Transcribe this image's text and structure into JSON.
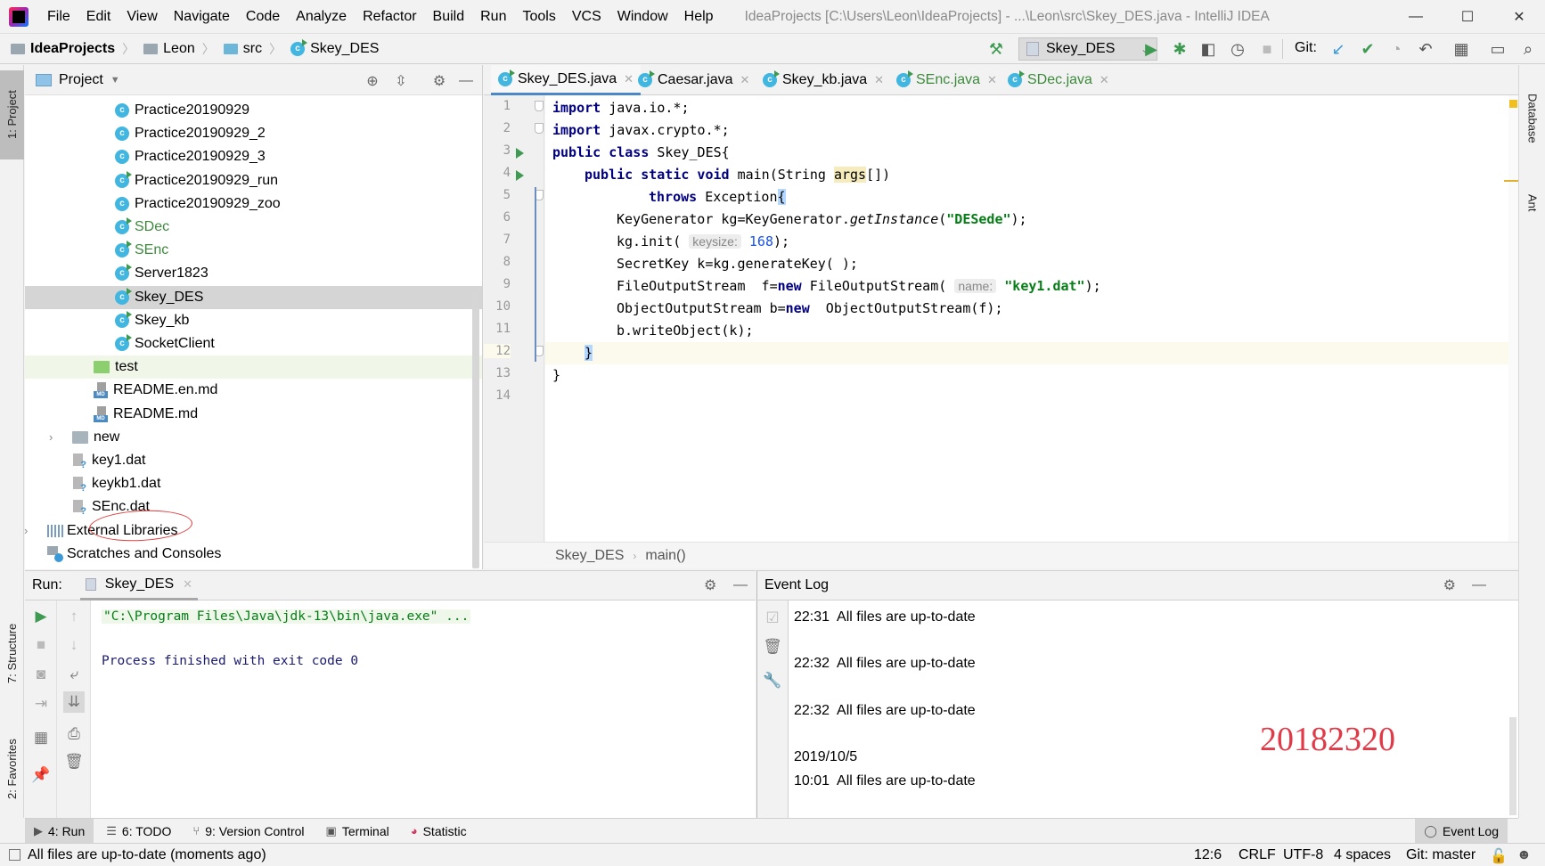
{
  "app": {
    "window_title": "IdeaProjects [C:\\Users\\Leon\\IdeaProjects] - ...\\Leon\\src\\Skey_DES.java - IntelliJ IDEA",
    "menu": [
      "File",
      "Edit",
      "View",
      "Navigate",
      "Code",
      "Analyze",
      "Refactor",
      "Build",
      "Run",
      "Tools",
      "VCS",
      "Window",
      "Help"
    ],
    "window_controls": {
      "minimize": "—",
      "maximize": "☐",
      "close": "✕"
    }
  },
  "navbar": {
    "breadcrumb": [
      "IdeaProjects",
      "Leon",
      "src",
      "Skey_DES"
    ],
    "run_config": "Skey_DES",
    "git_label": "Git:"
  },
  "project_panel": {
    "title": "Project",
    "tree": [
      {
        "label": "Practice20190929",
        "type": "class",
        "color": "normal"
      },
      {
        "label": "Practice20190929_2",
        "type": "class",
        "color": "normal"
      },
      {
        "label": "Practice20190929_3",
        "type": "class",
        "color": "normal"
      },
      {
        "label": "Practice20190929_run",
        "type": "class-run",
        "color": "normal"
      },
      {
        "label": "Practice20190929_zoo",
        "type": "class",
        "color": "normal"
      },
      {
        "label": "SDec",
        "type": "class-run",
        "color": "green"
      },
      {
        "label": "SEnc",
        "type": "class-run",
        "color": "green"
      },
      {
        "label": "Server1823",
        "type": "class-run",
        "color": "normal"
      },
      {
        "label": "Skey_DES",
        "type": "class-run",
        "color": "normal",
        "selected": true
      },
      {
        "label": "Skey_kb",
        "type": "class-run",
        "color": "normal"
      },
      {
        "label": "SocketClient",
        "type": "class-run",
        "color": "normal"
      },
      {
        "label": "test",
        "type": "folder-test"
      },
      {
        "label": "README.en.md",
        "type": "md"
      },
      {
        "label": "README.md",
        "type": "md"
      },
      {
        "label": "new",
        "type": "folder",
        "collapsed": true
      },
      {
        "label": "key1.dat",
        "type": "dat",
        "annotated": true
      },
      {
        "label": "keykb1.dat",
        "type": "dat"
      },
      {
        "label": "SEnc.dat",
        "type": "dat"
      },
      {
        "label": "External Libraries",
        "type": "libraries",
        "collapsed": true
      },
      {
        "label": "Scratches and Consoles",
        "type": "scratches"
      }
    ]
  },
  "editor": {
    "tabs": [
      {
        "label": "Skey_DES.java",
        "active": true,
        "color": "normal"
      },
      {
        "label": "Caesar.java",
        "color": "normal"
      },
      {
        "label": "Skey_kb.java",
        "color": "normal"
      },
      {
        "label": "SEnc.java",
        "color": "green"
      },
      {
        "label": "SDec.java",
        "color": "green"
      }
    ],
    "line_numbers": [
      "1",
      "2",
      "3",
      "4",
      "5",
      "6",
      "7",
      "8",
      "9",
      "10",
      "11",
      "12",
      "13",
      "14"
    ],
    "code": {
      "l1_kw": "import",
      "l1_rest": " java.io.*;",
      "l2_kw": "import",
      "l2_rest": " javax.crypto.*;",
      "l3_kw": "public class",
      "l3_rest": " Skey_DES{",
      "l4_kw": "public static void",
      "l4_a": " main(String ",
      "l4_arg": "args",
      "l4_b": "[])",
      "l5_kw": "throws",
      "l5_a": " Exception",
      "l5_brace": "{",
      "l6_a": "KeyGenerator kg=KeyGenerator.",
      "l6_it": "getInstance",
      "l6_b": "(",
      "l6_str": "\"DESede\"",
      "l6_c": ");",
      "l7_a": "kg.init( ",
      "l7_hint": "keysize:",
      "l7_num": "168",
      "l7_b": ");",
      "l8": "SecretKey k=kg.generateKey( );",
      "l9_a": "FileOutputStream  f=",
      "l9_kw": "new",
      "l9_b": " FileOutputStream( ",
      "l9_hint": "name:",
      "l9_str": "\"key1.dat\"",
      "l9_c": ");",
      "l10_a": "ObjectOutputStream b=",
      "l10_kw": "new",
      "l10_b": "  ObjectOutputStream(f);",
      "l11": "b.writeObject(k);",
      "l12": "}",
      "l13": "}"
    },
    "breadcrumb": [
      "Skey_DES",
      "main()"
    ]
  },
  "right_stripe": [
    "Database",
    "Ant"
  ],
  "left_stripe": [
    "1: Project",
    "7: Structure",
    "2: Favorites"
  ],
  "run_panel": {
    "label": "Run:",
    "tab": "Skey_DES",
    "console": [
      "\"C:\\Program Files\\Java\\jdk-13\\bin\\java.exe\" ...",
      "Process finished with exit code 0"
    ]
  },
  "event_log": {
    "title": "Event Log",
    "entries": [
      {
        "time": "22:31",
        "message": "All files are up-to-date"
      },
      {
        "time": "22:32",
        "message": "All files are up-to-date"
      },
      {
        "time": "22:32",
        "message": "All files are up-to-date"
      },
      {
        "date": "2019/10/5"
      },
      {
        "time": "10:01",
        "message": "All files are up-to-date"
      }
    ],
    "watermark": "20182320"
  },
  "tool_tabs": [
    {
      "label": "4: Run",
      "icon": "run",
      "active": true
    },
    {
      "label": "6: TODO",
      "icon": "todo"
    },
    {
      "label": "9: Version Control",
      "icon": "vcs"
    },
    {
      "label": "Terminal",
      "icon": "terminal"
    },
    {
      "label": "Statistic",
      "icon": "statistic"
    },
    {
      "label": "Event Log",
      "icon": "event-log"
    }
  ],
  "statusbar": {
    "message": "All files are up-to-date (moments ago)",
    "position": "12:6",
    "line_separator": "CRLF",
    "encoding": "UTF-8",
    "indent": "4 spaces",
    "git_branch": "Git: master"
  }
}
